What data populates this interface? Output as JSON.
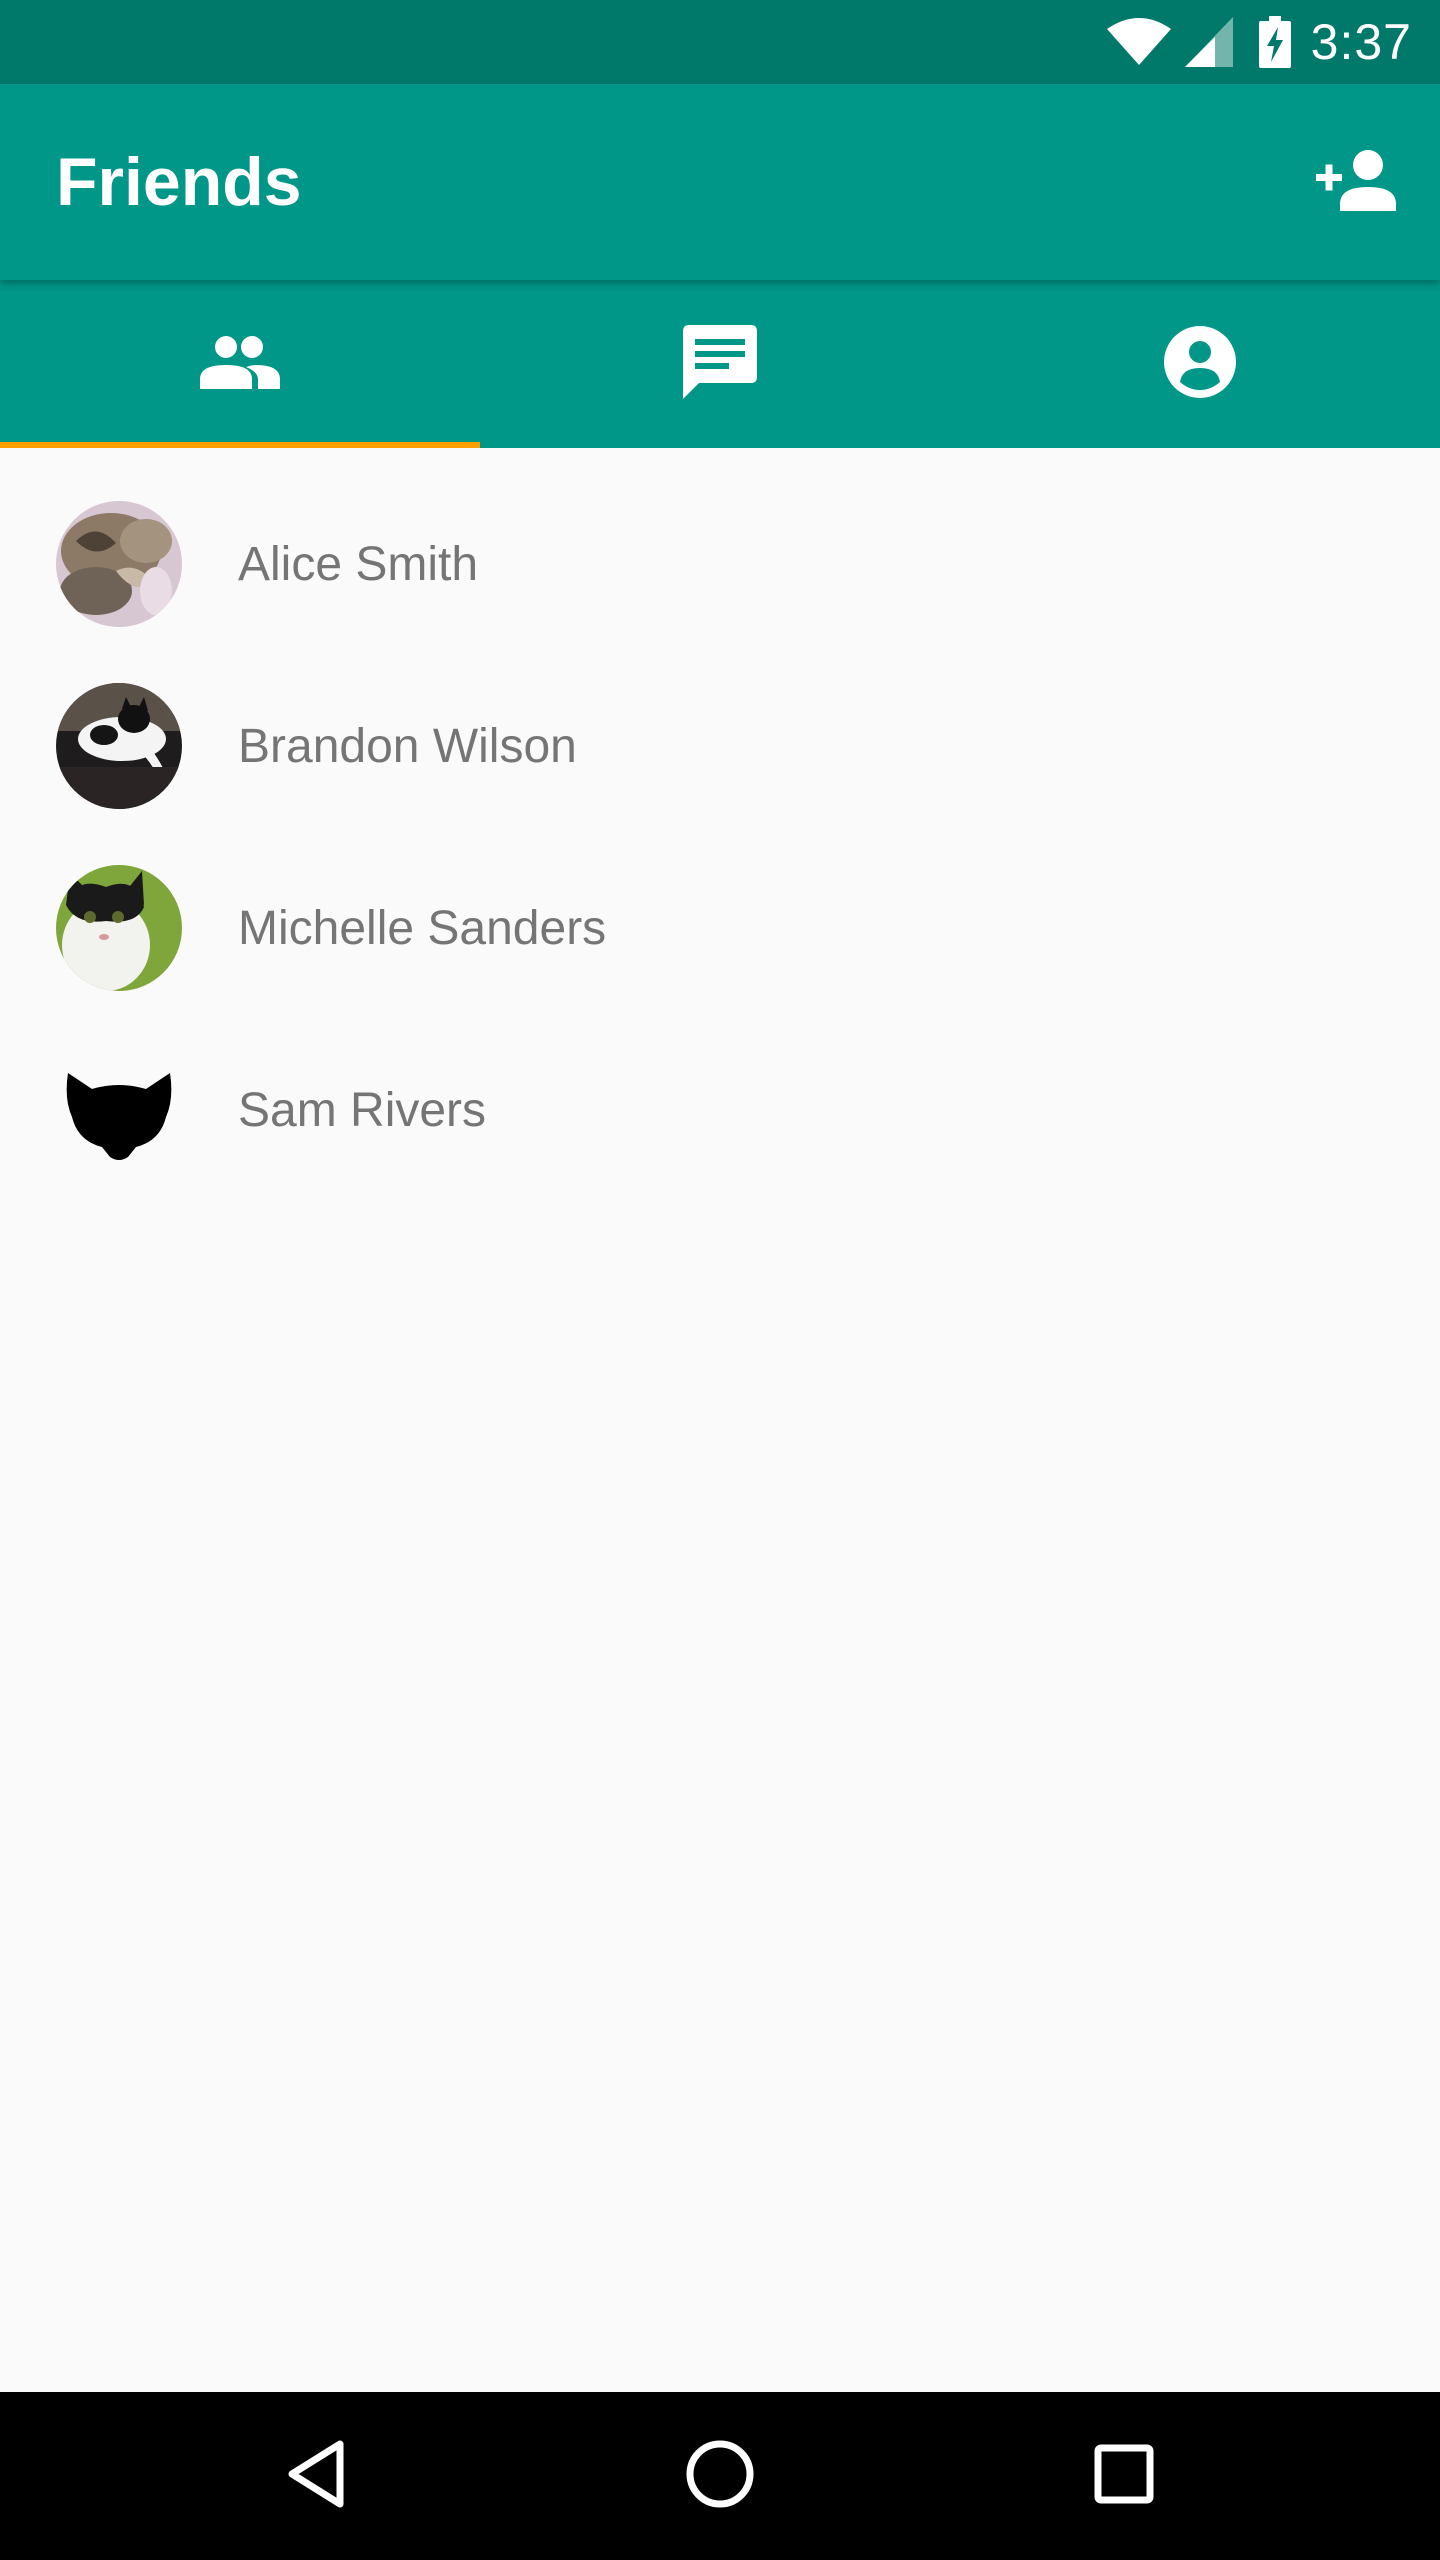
{
  "status_bar": {
    "time": "3:37",
    "icons": [
      "wifi-icon",
      "cell-signal-icon",
      "battery-charging-icon"
    ]
  },
  "app_bar": {
    "title": "Friends",
    "action_icon": "add-person-icon"
  },
  "tabs": [
    {
      "icon": "people-icon",
      "selected": true
    },
    {
      "icon": "chat-icon",
      "selected": false
    },
    {
      "icon": "account-circle-icon",
      "selected": false
    }
  ],
  "friends": [
    {
      "name": "Alice Smith",
      "avatar": "tabby-cat-photo"
    },
    {
      "name": "Brandon Wilson",
      "avatar": "black-white-cat-photo"
    },
    {
      "name": "Michelle Sanders",
      "avatar": "tuxedo-cat-photo"
    },
    {
      "name": "Sam Rivers",
      "avatar": "cat-silhouette-icon"
    }
  ],
  "nav_bar": {
    "icons": [
      "back-icon",
      "home-icon",
      "recents-icon"
    ]
  },
  "colors": {
    "status_bar": "#00796b",
    "primary": "#009688",
    "accent": "#ffa000",
    "background": "#fafafa",
    "name_text": "#757575"
  }
}
